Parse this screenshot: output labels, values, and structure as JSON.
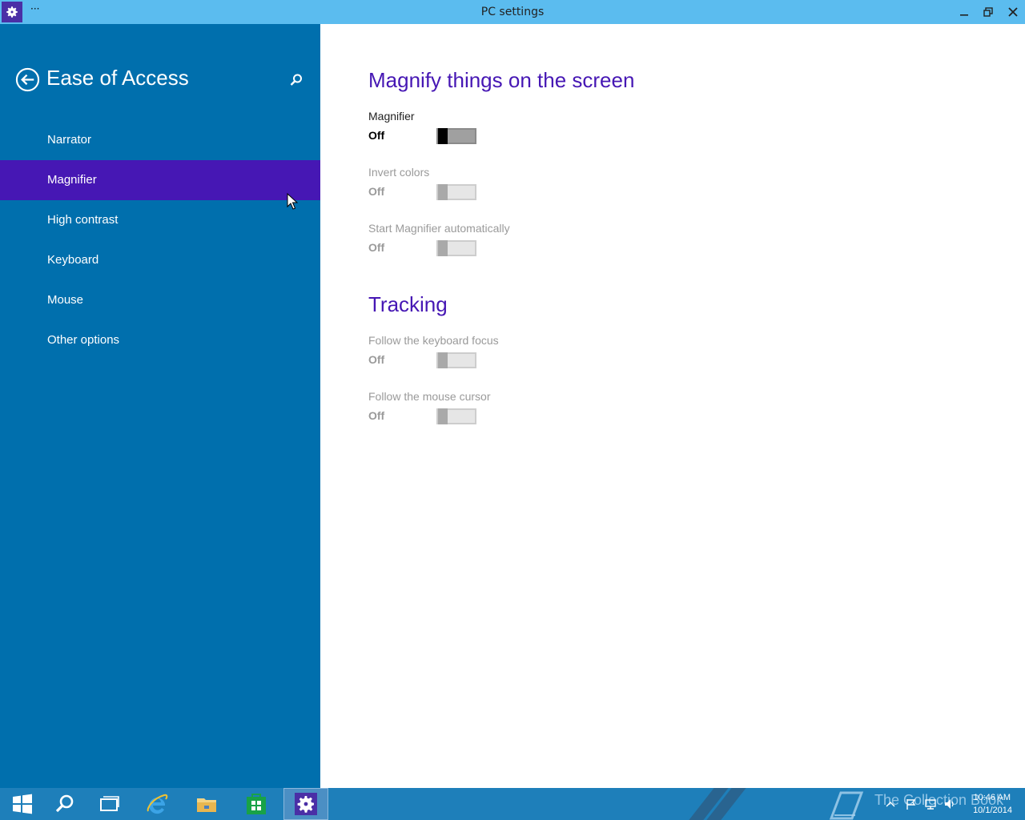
{
  "window": {
    "title": "PC settings",
    "menu_glyph": "···",
    "app_icon": "gear-icon",
    "controls": [
      "minimize-icon",
      "restore-icon",
      "close-icon"
    ]
  },
  "sidebar": {
    "title": "Ease of Access",
    "back_icon": "back-arrow-icon",
    "search_icon": "search-icon",
    "items": [
      {
        "label": "Narrator",
        "selected": false
      },
      {
        "label": "Magnifier",
        "selected": true
      },
      {
        "label": "High contrast",
        "selected": false
      },
      {
        "label": "Keyboard",
        "selected": false
      },
      {
        "label": "Mouse",
        "selected": false
      },
      {
        "label": "Other options",
        "selected": false
      }
    ]
  },
  "main": {
    "section1": {
      "title": "Magnify things on the screen",
      "settings": [
        {
          "label": "Magnifier",
          "state": "Off",
          "enabled": true,
          "on": false
        },
        {
          "label": "Invert colors",
          "state": "Off",
          "enabled": false,
          "on": false
        },
        {
          "label": "Start Magnifier automatically",
          "state": "Off",
          "enabled": false,
          "on": false
        }
      ]
    },
    "section2": {
      "title": "Tracking",
      "settings": [
        {
          "label": "Follow the keyboard focus",
          "state": "Off",
          "enabled": false,
          "on": false
        },
        {
          "label": "Follow the mouse cursor",
          "state": "Off",
          "enabled": false,
          "on": false
        }
      ]
    }
  },
  "taskbar": {
    "buttons": [
      "windows-start-icon",
      "search-icon",
      "task-view-icon",
      "internet-explorer-icon",
      "file-explorer-icon",
      "store-icon",
      "pc-settings-icon"
    ],
    "watermark": "The Collection Book",
    "clock_time": "10:46 AM",
    "clock_date": "10/1/2014"
  },
  "colors": {
    "titlebar": "#5bbcef",
    "sidebar": "#006fad",
    "selected": "#4617b4",
    "heading": "#4617b4",
    "taskbar": "#1e7fba"
  }
}
